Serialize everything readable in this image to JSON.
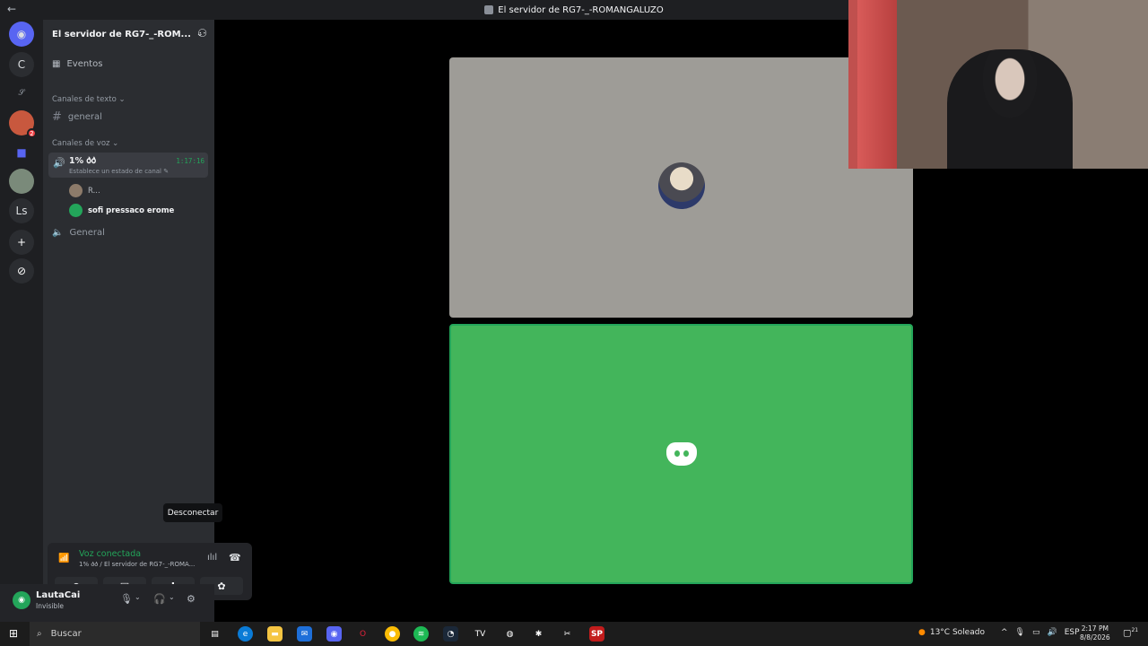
{
  "window": {
    "title": "El servidor de RG7-_-ROMANGALUZO"
  },
  "rail": {
    "items": [
      "C",
      "Ls"
    ],
    "badge": "2"
  },
  "sidebar": {
    "server_name": "El servidor de RG7-_-ROM...",
    "events_label": "Eventos",
    "text_category": "Canales de texto",
    "text_channels": [
      "general"
    ],
    "voice_category": "Canales de voz",
    "active_voice": {
      "name": "1% 𐌳𐌳",
      "timer": "1:17:16",
      "status": "Establece un estado de canal"
    },
    "members": [
      {
        "name": "R..."
      },
      {
        "name": "sofi pressaco erome"
      }
    ],
    "other_voice": "General"
  },
  "voice_panel": {
    "title": "Voz conectada",
    "subtitle": "1% 𐌳𐌳 / El servidor de RG7-_-ROMA..."
  },
  "tooltip": "Desconectar",
  "user": {
    "name": "LautaCai",
    "status": "Invisible"
  },
  "taskbar": {
    "search": "Buscar",
    "weather": "13°C  Soleado",
    "lang": "ESP",
    "time": "2:17 PM",
    "date": "8/8/2026",
    "notif": "21"
  },
  "colors": {
    "green": "#23a55a",
    "tile_green": "#43b55b",
    "tile_gray": "#9e9c97"
  }
}
